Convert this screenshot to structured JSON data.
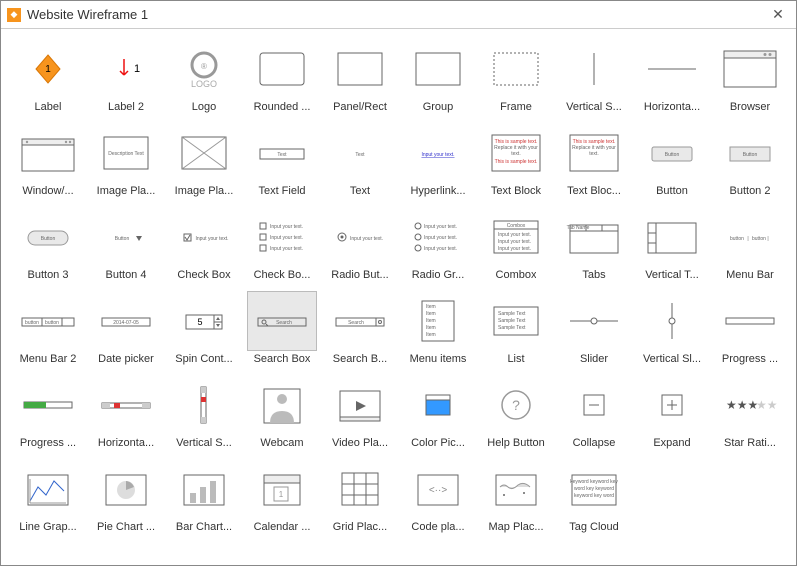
{
  "window": {
    "title": "Website Wireframe 1"
  },
  "shapes": [
    {
      "label": "Label"
    },
    {
      "label": "Label 2"
    },
    {
      "label": "Logo"
    },
    {
      "label": "Rounded ..."
    },
    {
      "label": "Panel/Rect"
    },
    {
      "label": "Group"
    },
    {
      "label": "Frame"
    },
    {
      "label": "Vertical S..."
    },
    {
      "label": "Horizonta..."
    },
    {
      "label": "Browser"
    },
    {
      "label": "Window/..."
    },
    {
      "label": "Image Pla..."
    },
    {
      "label": "Image Pla..."
    },
    {
      "label": "Text Field"
    },
    {
      "label": "Text"
    },
    {
      "label": "Hyperlink..."
    },
    {
      "label": "Text Block"
    },
    {
      "label": "Text Bloc..."
    },
    {
      "label": "Button"
    },
    {
      "label": "Button 2"
    },
    {
      "label": "Button 3"
    },
    {
      "label": "Button 4"
    },
    {
      "label": "Check Box"
    },
    {
      "label": "Check Bo..."
    },
    {
      "label": "Radio But..."
    },
    {
      "label": "Radio Gr..."
    },
    {
      "label": "Combox"
    },
    {
      "label": "Tabs"
    },
    {
      "label": "Vertical T..."
    },
    {
      "label": "Menu Bar"
    },
    {
      "label": "Menu Bar 2"
    },
    {
      "label": "Date picker"
    },
    {
      "label": "Spin Cont..."
    },
    {
      "label": "Search Box",
      "selected": true
    },
    {
      "label": "Search B..."
    },
    {
      "label": "Menu items"
    },
    {
      "label": "List"
    },
    {
      "label": "Slider"
    },
    {
      "label": "Vertical Sl..."
    },
    {
      "label": "Progress ..."
    },
    {
      "label": "Progress ..."
    },
    {
      "label": "Horizonta..."
    },
    {
      "label": "Vertical S..."
    },
    {
      "label": "Webcam"
    },
    {
      "label": "Video Pla..."
    },
    {
      "label": "Color Pic..."
    },
    {
      "label": "Help Button"
    },
    {
      "label": "Collapse"
    },
    {
      "label": "Expand"
    },
    {
      "label": "Star Rati..."
    },
    {
      "label": "Line Grap..."
    },
    {
      "label": "Pie Chart ..."
    },
    {
      "label": "Bar Chart..."
    },
    {
      "label": "Calendar ..."
    },
    {
      "label": "Grid Plac..."
    },
    {
      "label": "Code pla..."
    },
    {
      "label": "Map Plac..."
    },
    {
      "label": "Tag Cloud"
    }
  ],
  "misc": {
    "button_text": "Button",
    "text_label": "Text",
    "date": "2014-07-05",
    "spin": "5",
    "search": "Search",
    "sample": "Sample Text",
    "input": "Input your text.",
    "combox": "Combox",
    "item": "Item",
    "textblock": "This is sample text. Replace it with your text."
  }
}
